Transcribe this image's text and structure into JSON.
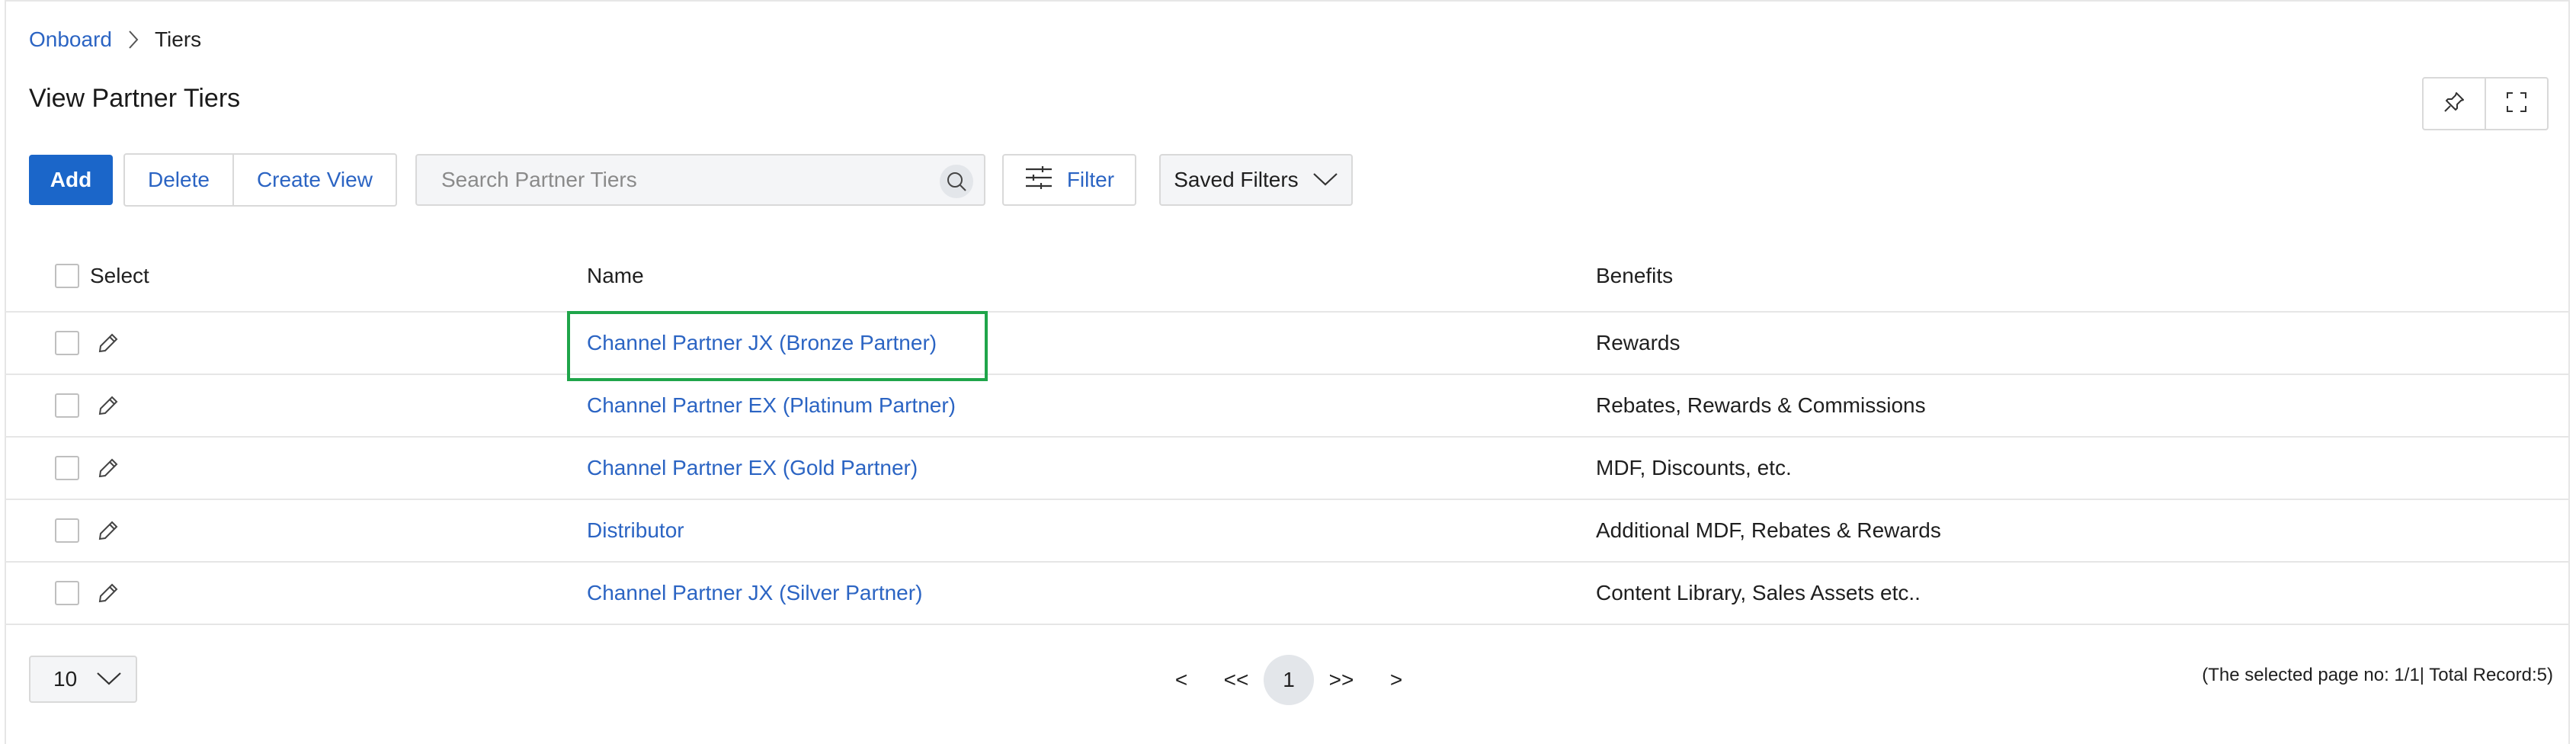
{
  "breadcrumb": {
    "parent": "Onboard",
    "current": "Tiers"
  },
  "page": {
    "title": "View Partner Tiers"
  },
  "toolbar": {
    "add_label": "Add",
    "delete_label": "Delete",
    "create_view_label": "Create View",
    "search_placeholder": "Search Partner Tiers",
    "filter_label": "Filter",
    "saved_filters_label": "Saved Filters"
  },
  "table": {
    "headers": {
      "select": "Select",
      "name": "Name",
      "benefits": "Benefits"
    },
    "rows": [
      {
        "name": "Channel Partner JX (Bronze Partner)",
        "benefits": "Rewards"
      },
      {
        "name": "Channel Partner EX (Platinum Partner)",
        "benefits": "Rebates, Rewards & Commissions"
      },
      {
        "name": "Channel Partner EX (Gold Partner)",
        "benefits": "MDF, Discounts, etc."
      },
      {
        "name": "Distributor",
        "benefits": "Additional MDF, Rebates & Rewards"
      },
      {
        "name": "Channel Partner JX (Silver Partner)",
        "benefits": "Content Library, Sales Assets etc.."
      }
    ]
  },
  "pagination": {
    "page_size": "10",
    "prev": "<",
    "first": "<<",
    "current": "1",
    "last": ">>",
    "next": ">",
    "info": "(The selected page no: 1/1| Total Record:5)"
  },
  "colors": {
    "accent": "#1b66c9",
    "link": "#2b64c3",
    "highlight": "#1fa54a"
  }
}
